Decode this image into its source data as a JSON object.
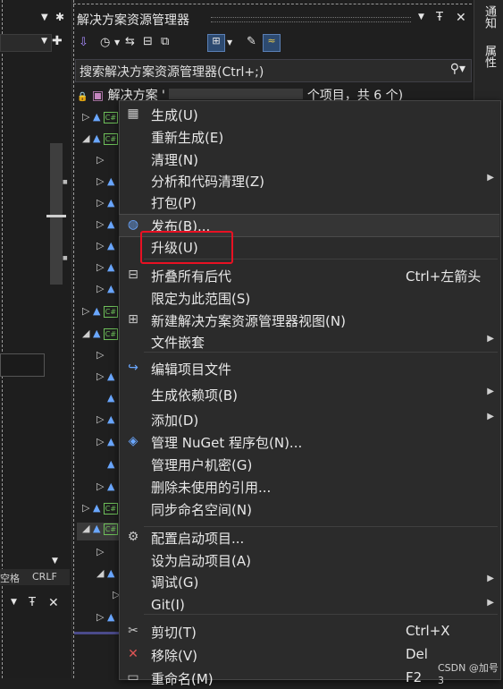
{
  "solution_explorer": {
    "title": "解决方案资源管理器",
    "search_placeholder": "搜索解决方案资源管理器(Ctrl+;)",
    "solution_row_prefix": "解决方案 '",
    "solution_row_suffix": "个项目，共 6 个)"
  },
  "left_panel": {
    "status_left": "空格",
    "status_right": "CRLF"
  },
  "right_strip": {
    "tab_notify": "通知",
    "tab_properties": "属性"
  },
  "context_menu": {
    "items": [
      {
        "label": "生成(U)",
        "icon": "build-icon"
      },
      {
        "label": "重新生成(E)"
      },
      {
        "label": "清理(N)"
      },
      {
        "label": "分析和代码清理(Z)",
        "submenu": true
      },
      {
        "label": "打包(P)"
      },
      {
        "label": "发布(B)...",
        "icon": "publish-globe-icon"
      },
      {
        "label": "升级(U)"
      },
      {
        "label": "折叠所有后代",
        "shortcut": "Ctrl+左箭头",
        "icon": "collapse-icon"
      },
      {
        "label": "限定为此范围(S)"
      },
      {
        "label": "新建解决方案资源管理器视图(N)",
        "icon": "new-view-icon"
      },
      {
        "label": "文件嵌套",
        "submenu": true
      },
      {
        "label": "编辑项目文件",
        "icon": "edit-project-icon"
      },
      {
        "label": "生成依赖项(B)",
        "submenu": true
      },
      {
        "label": "添加(D)",
        "submenu": true
      },
      {
        "label": "管理 NuGet 程序包(N)...",
        "icon": "nuget-icon"
      },
      {
        "label": "管理用户机密(G)"
      },
      {
        "label": "删除未使用的引用..."
      },
      {
        "label": "同步命名空间(N)"
      },
      {
        "label": "配置启动项目...",
        "icon": "gear-icon"
      },
      {
        "label": "设为启动项目(A)"
      },
      {
        "label": "调试(G)",
        "submenu": true
      },
      {
        "label": "Git(I)",
        "submenu": true
      },
      {
        "label": "剪切(T)",
        "shortcut": "Ctrl+X",
        "icon": "cut-icon"
      },
      {
        "label": "移除(V)",
        "shortcut": "Del",
        "icon": "remove-icon"
      },
      {
        "label": "重命名(M)",
        "shortcut": "F2",
        "icon": "rename-icon"
      }
    ]
  },
  "watermark": "CSDN @加号3",
  "colors": {
    "background": "#1f1f1f",
    "menu_background": "#2b2b2b",
    "highlight": "#e81123",
    "accent": "#6aa7ff"
  }
}
